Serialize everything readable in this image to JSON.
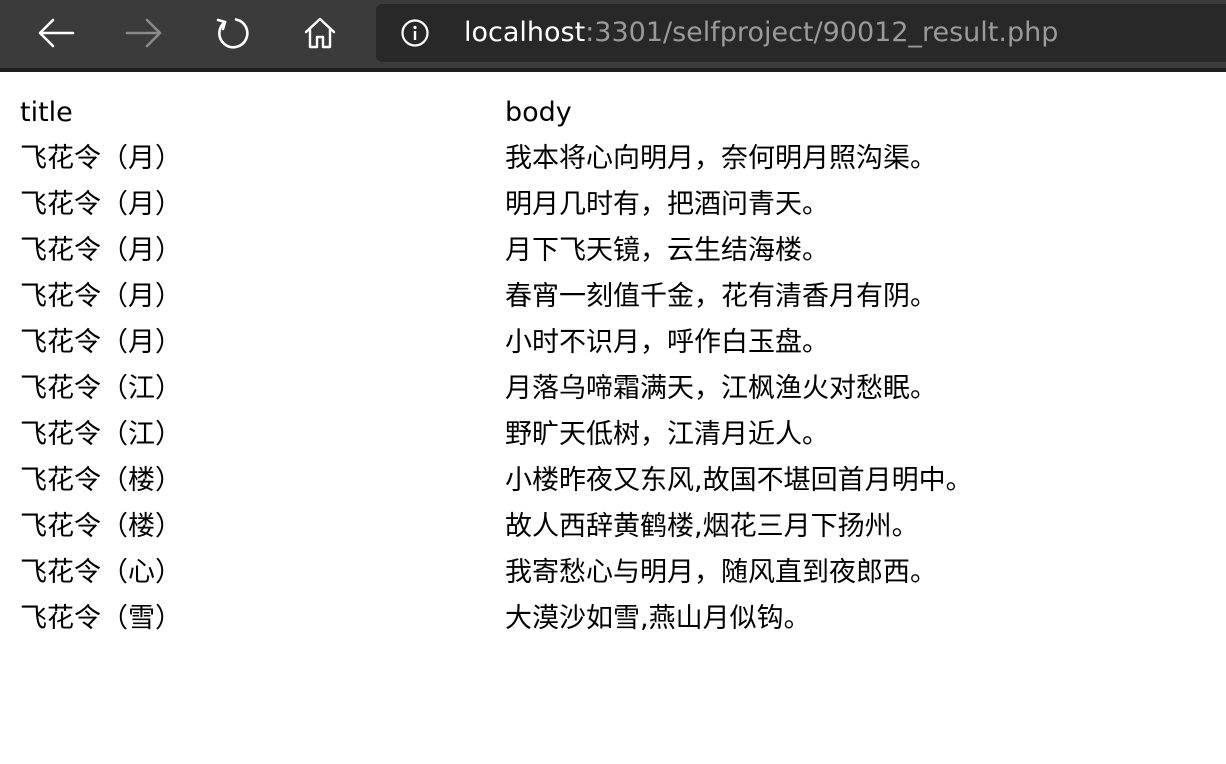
{
  "browser": {
    "url_host": "localhost",
    "url_path": ":3301/selfproject/90012_result.php",
    "icons": {
      "back": "back-arrow-icon",
      "forward": "forward-arrow-icon",
      "refresh": "refresh-icon",
      "home": "home-icon",
      "info": "info-icon"
    }
  },
  "table": {
    "headers": [
      "title",
      "body"
    ],
    "rows": [
      {
        "title": "飞花令（月）",
        "body": "我本将心向明月，奈何明月照沟渠。"
      },
      {
        "title": "飞花令（月）",
        "body": "明月几时有，把酒问青天。"
      },
      {
        "title": "飞花令（月）",
        "body": "月下飞天镜，云生结海楼。"
      },
      {
        "title": "飞花令（月）",
        "body": "春宵一刻值千金，花有清香月有阴。"
      },
      {
        "title": "飞花令（月）",
        "body": "小时不识月，呼作白玉盘。"
      },
      {
        "title": "飞花令（江）",
        "body": "月落乌啼霜满天，江枫渔火对愁眠。"
      },
      {
        "title": "飞花令（江）",
        "body": "野旷天低树，江清月近人。"
      },
      {
        "title": "飞花令（楼）",
        "body": "小楼昨夜又东风,故国不堪回首月明中。"
      },
      {
        "title": "飞花令（楼）",
        "body": "故人西辞黄鹤楼,烟花三月下扬州。"
      },
      {
        "title": "飞花令（心）",
        "body": "我寄愁心与明月，随风直到夜郎西。"
      },
      {
        "title": "飞花令（雪）",
        "body": "大漠沙如雪,燕山月似钩。"
      }
    ]
  }
}
